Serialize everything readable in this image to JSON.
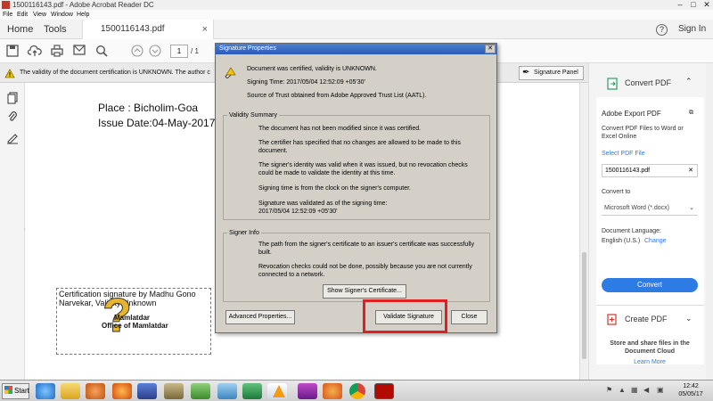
{
  "window": {
    "title": "1500116143.pdf - Adobe Acrobat Reader DC",
    "minimize": "–",
    "maximize": "□",
    "close": "✕"
  },
  "menubar": [
    "File",
    "Edit",
    "View",
    "Window",
    "Help"
  ],
  "topnav": {
    "home": "Home",
    "tools": "Tools",
    "doc_tab": "1500116143.pdf",
    "doc_tab_close": "×",
    "help": "?",
    "signin": "Sign In"
  },
  "toolbar": {
    "page_current": "1",
    "page_total": "/ 1"
  },
  "notification": {
    "message": "The validity of the document certification is UNKNOWN. The author c",
    "signature_panel": "Signature Panel"
  },
  "document": {
    "place": "Place : Bicholim-Goa",
    "issue_date": "Issue Date:04-May-2017",
    "cert_text": "Certification signature by Madhu Gono Narvekar, Validity Unknown",
    "seal_line1": "Mamlatdar",
    "seal_line2": "Office of Mamlatdar"
  },
  "dialog": {
    "title": "Signature Properties",
    "close": "✕",
    "summary_line1": "Document was certified, validity is UNKNOWN.",
    "summary_line2": "Signing Time: 2017/05/04 12:52:09 +05'30'",
    "summary_line3": "Source of Trust obtained from Adobe Approved Trust List (AATL).",
    "validity_label": "Validity Summary",
    "validity_items": [
      "The document has not been modified since it was certified.",
      "The certifier has specified that no changes are allowed to be made to this document.",
      "The signer's identity was valid when it was issued, but no revocation checks could be made to validate the identity at this time.",
      "Signing time is from the clock on the signer's computer.",
      "Signature was validated as of the signing time:\n2017/05/04 12:52:09 +05'30'"
    ],
    "signer_label": "Signer Info",
    "signer_items": [
      "The path from the signer's certificate to an issuer's certificate was successfully built.",
      "Revocation checks could not be done, possibly because you are not currently connected to a network."
    ],
    "show_cert": "Show Signer's Certificate...",
    "advanced": "Advanced Properties...",
    "validate": "Validate Signature",
    "close_btn": "Close"
  },
  "rightpanel": {
    "convert_pdf": "Convert PDF",
    "export_title": "Adobe Export PDF",
    "export_desc": "Convert PDF Files to Word or Excel Online",
    "select_file": "Select PDF File",
    "file_name": "1500116143.pdf",
    "convert_to": "Convert to",
    "convert_option": "Microsoft Word (*.docx)",
    "doc_language": "Document Language:",
    "language": "English (U.S.)",
    "change": "Change",
    "convert_btn": "Convert",
    "create_pdf": "Create PDF",
    "store_text": "Store and share files in the Document Cloud",
    "learn_more": "Learn More"
  },
  "taskbar": {
    "start": "Start",
    "time": "12:42",
    "date": "05/05/17"
  },
  "colors": {
    "accent": "#2d7be5",
    "validate_highlight": "#e02020",
    "dialog_bg": "#d4d0c8"
  }
}
